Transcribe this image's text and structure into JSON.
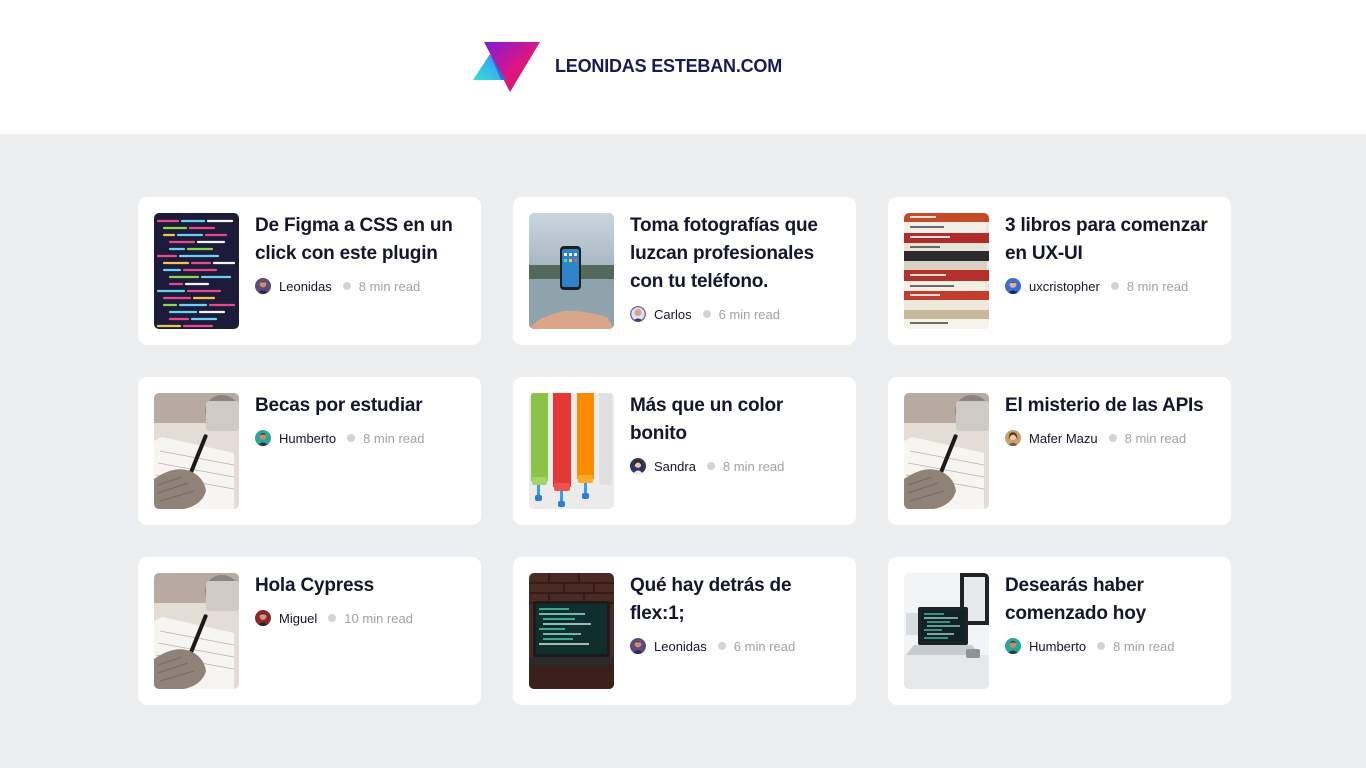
{
  "site": {
    "title": "LEONIDAS ESTEBAN.COM",
    "logo_icon": "triangle-gradient-logo",
    "colors": {
      "brand_magenta": "#d1127a",
      "brand_cyan": "#21d4d8",
      "title": "#1a1a52"
    }
  },
  "posts": [
    {
      "title": "De Figma a CSS en un click con este plugin",
      "author": "Leonidas",
      "read_time": "8 min read",
      "image": "code-screen"
    },
    {
      "title": "Toma fotografías que luzcan profesionales con tu teléfono.",
      "author": "Carlos",
      "read_time": "6 min read",
      "image": "hand-phone"
    },
    {
      "title": "3 libros para comenzar en UX-UI",
      "author": "uxcristopher",
      "read_time": "8 min read",
      "image": "book-stack"
    },
    {
      "title": "Becas por estudiar",
      "author": "Humberto",
      "read_time": "8 min read",
      "image": "writing-desk"
    },
    {
      "title": "Más que un color bonito",
      "author": "Sandra",
      "read_time": "8 min read",
      "image": "paint-rollers"
    },
    {
      "title": "El misterio de las APIs",
      "author": "Mafer Mazu",
      "read_time": "8 min read",
      "image": "writing-desk"
    },
    {
      "title": "Hola Cypress",
      "author": "Miguel",
      "read_time": "10 min read",
      "image": "writing-desk"
    },
    {
      "title": "Qué hay detrás de flex:1;",
      "author": "Leonidas",
      "read_time": "6 min read",
      "image": "laptop-brick"
    },
    {
      "title": "Desearás haber comenzado hoy",
      "author": "Humberto",
      "read_time": "8 min read",
      "image": "laptop-desk"
    }
  ]
}
